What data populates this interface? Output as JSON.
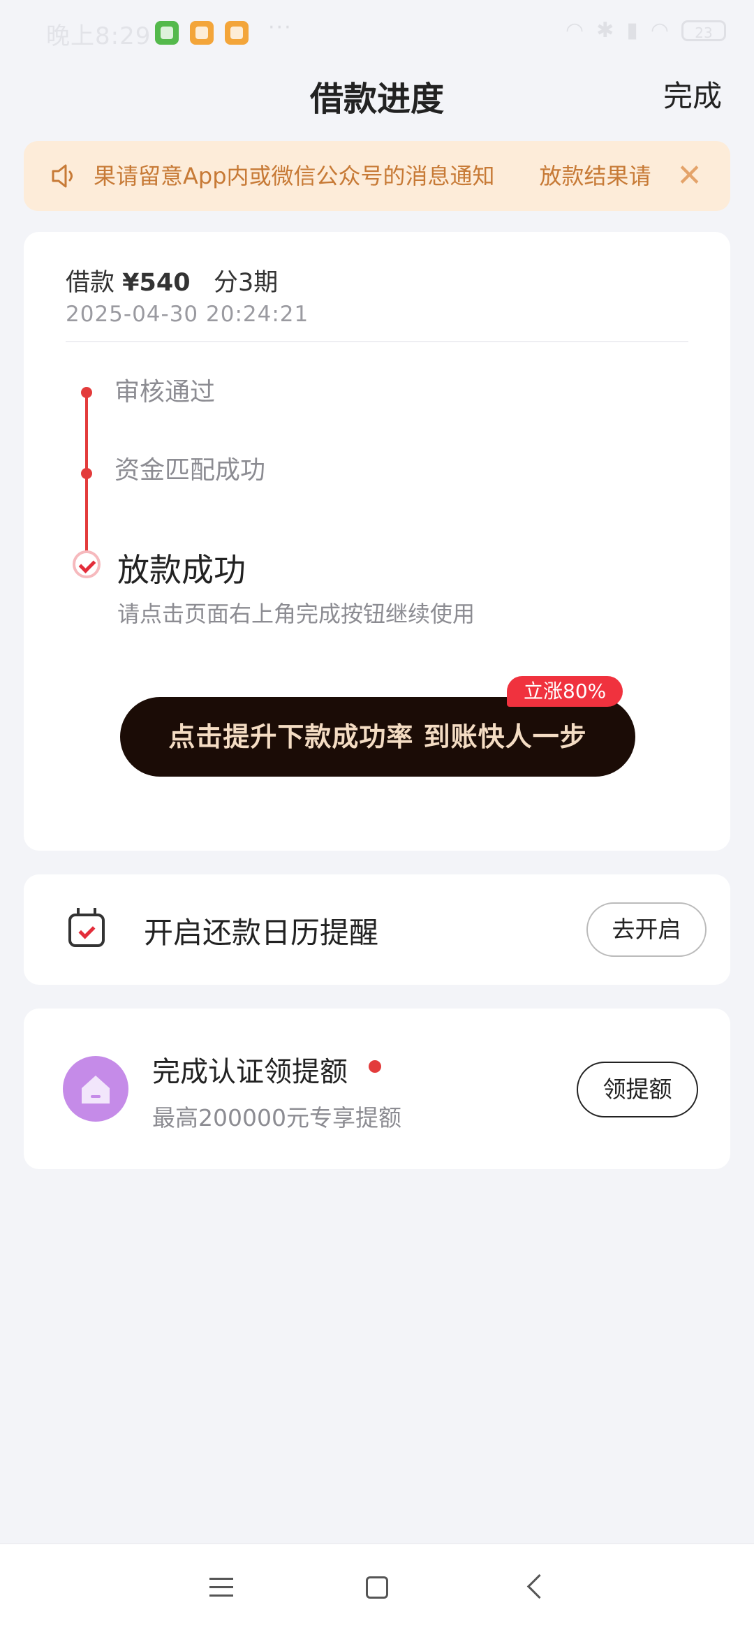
{
  "status_bar": {
    "time": "晚上8:29",
    "more": "···",
    "battery": "23"
  },
  "header": {
    "title": "借款进度",
    "done_label": "完成"
  },
  "notice": {
    "text": "果请留意App内或微信公众号的消息通知　　放款结果请",
    "close": "✕"
  },
  "loan": {
    "amount_label": "借款",
    "amount": "¥540",
    "installments": "分3期",
    "datetime": "2025-04-30 20:24:21"
  },
  "timeline": {
    "step1": "审核通过",
    "step2": "资金匹配成功",
    "step3_title": "放款成功",
    "step3_desc": "请点击页面右上角完成按钮继续使用"
  },
  "boost": {
    "label": "点击提升下款成功率 到账快人一步",
    "badge": "立涨80%"
  },
  "calendar_card": {
    "label": "开启还款日历提醒",
    "button": "去开启"
  },
  "cert_card": {
    "title": "完成认证领提额",
    "subtitle": "最高200000元专享提额",
    "button": "领提额"
  },
  "colors": {
    "accent_red": "#e33b3b",
    "notice_bg": "#fdecd9",
    "notice_text": "#c77a36",
    "boost_bg": "#1b0c06"
  }
}
